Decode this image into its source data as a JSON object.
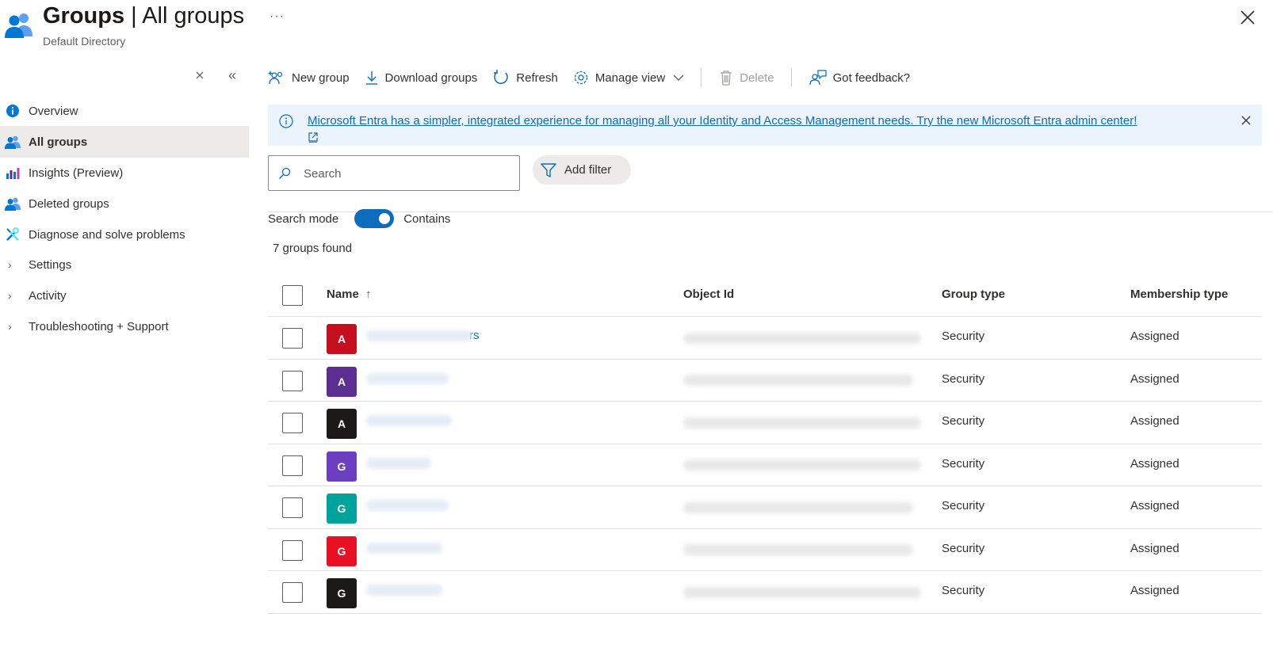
{
  "header": {
    "title_main": "Groups",
    "title_sep": " | ",
    "title_rest": "All groups",
    "subtitle": "Default Directory",
    "more": "···"
  },
  "sidebar": {
    "items": [
      {
        "label": "Overview",
        "icon": "info-icon",
        "active": false
      },
      {
        "label": "All groups",
        "icon": "groups-icon",
        "active": true
      },
      {
        "label": "Insights (Preview)",
        "icon": "insights-icon",
        "active": false
      },
      {
        "label": "Deleted groups",
        "icon": "groups-icon",
        "active": false
      },
      {
        "label": "Diagnose and solve problems",
        "icon": "wrench-icon",
        "active": false
      },
      {
        "label": "Settings",
        "icon": "chevron-right-icon",
        "active": false
      },
      {
        "label": "Activity",
        "icon": "chevron-right-icon",
        "active": false
      },
      {
        "label": "Troubleshooting + Support",
        "icon": "chevron-right-icon",
        "active": false
      }
    ]
  },
  "toolbar": {
    "new_group": "New group",
    "download_groups": "Download groups",
    "refresh": "Refresh",
    "manage_view": "Manage view",
    "delete": "Delete",
    "feedback": "Got feedback?"
  },
  "banner": {
    "text": "Microsoft Entra has a simpler, integrated experience for managing all your Identity and Access Management needs. Try the new Microsoft Entra admin center!"
  },
  "search": {
    "placeholder": "Search",
    "filter_label": "Add filter",
    "mode_label": "Search mode",
    "mode_value": "Contains"
  },
  "results": {
    "count_text": "7 groups found"
  },
  "table": {
    "columns": {
      "name": "Name",
      "sort_indicator": "↑",
      "object_id": "Object Id",
      "group_type": "Group type",
      "membership_type": "Membership type"
    },
    "rows": [
      {
        "initial": "A",
        "color": "#c50f1f",
        "name_suffix": "rs",
        "group_type": "Security",
        "membership_type": "Assigned"
      },
      {
        "initial": "A",
        "color": "#5c2e91",
        "name_suffix": "",
        "group_type": "Security",
        "membership_type": "Assigned"
      },
      {
        "initial": "A",
        "color": "#1b1a19",
        "name_suffix": "",
        "group_type": "Security",
        "membership_type": "Assigned"
      },
      {
        "initial": "G",
        "color": "#6b3fbf",
        "name_suffix": "",
        "group_type": "Security",
        "membership_type": "Assigned"
      },
      {
        "initial": "G",
        "color": "#00a39b",
        "name_suffix": "",
        "group_type": "Security",
        "membership_type": "Assigned"
      },
      {
        "initial": "G",
        "color": "#e81123",
        "name_suffix": "",
        "group_type": "Security",
        "membership_type": "Assigned"
      },
      {
        "initial": "G",
        "color": "#1b1a19",
        "name_suffix": "",
        "group_type": "Security",
        "membership_type": "Assigned"
      }
    ]
  },
  "colors": {
    "accent": "#0f6cbd",
    "banner_bg": "#ebf3fc",
    "active_nav_bg": "#edebe9"
  }
}
